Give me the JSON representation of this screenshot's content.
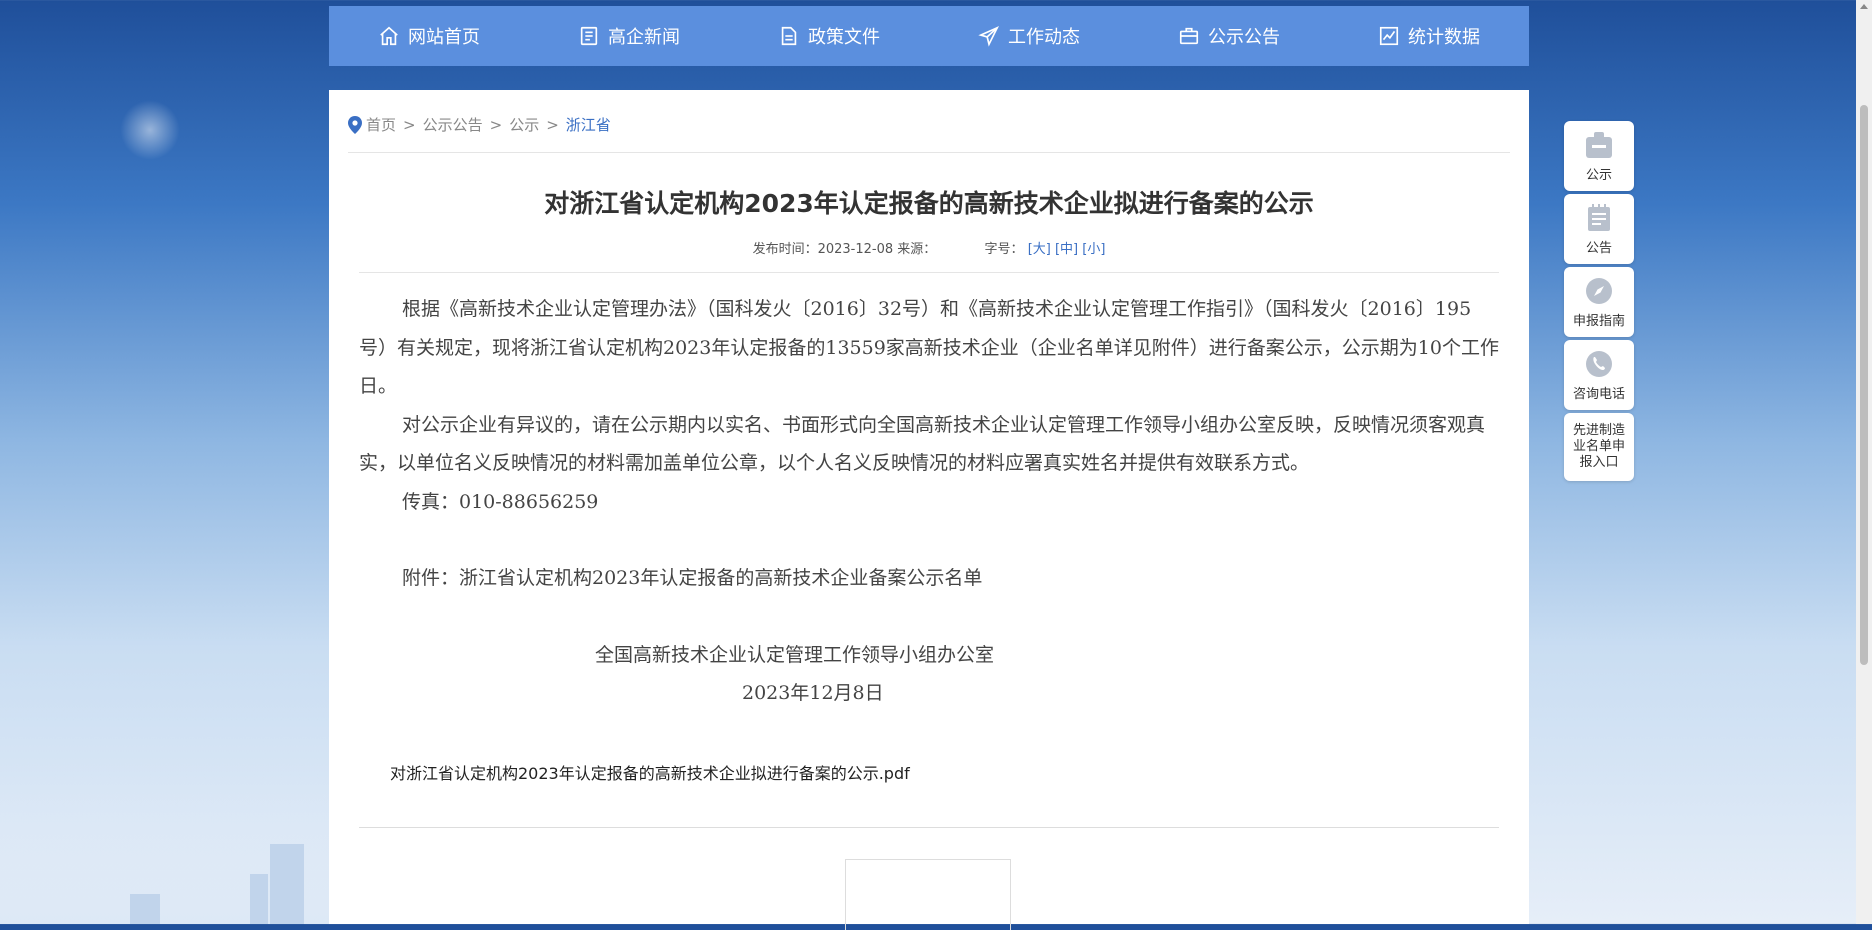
{
  "nav": {
    "items": [
      {
        "label": "网站首页",
        "icon": "home-icon"
      },
      {
        "label": "高企新闻",
        "icon": "news-icon"
      },
      {
        "label": "政策文件",
        "icon": "document-icon"
      },
      {
        "label": "工作动态",
        "icon": "paper-plane-icon"
      },
      {
        "label": "公示公告",
        "icon": "briefcase-icon"
      },
      {
        "label": "统计数据",
        "icon": "chart-icon"
      }
    ]
  },
  "breadcrumb": {
    "items": [
      "首页",
      "公示公告",
      "公示",
      "浙江省"
    ],
    "separator": ">"
  },
  "article": {
    "title": "对浙江省认定机构2023年认定报备的高新技术企业拟进行备案的公示",
    "meta_publish": "发布时间：2023-12-08 来源：",
    "meta_fontsize_label": "字号：",
    "size_large": "[大]",
    "size_medium": "[中]",
    "size_small": "[小]",
    "paragraphs": [
      "根据《高新技术企业认定管理办法》（国科发火〔2016〕32号）和《高新技术企业认定管理工作指引》（国科发火〔2016〕195号）有关规定，现将浙江省认定机构2023年认定报备的13559家高新技术企业（企业名单详见附件）进行备案公示，公示期为10个工作日。",
      "对公示企业有异议的，请在公示期内以实名、书面形式向全国高新技术企业认定管理工作领导小组办公室反映，反映情况须客观真实，以单位名义反映情况的材料需加盖单位公章，以个人名义反映情况的材料应署真实姓名并提供有效联系方式。",
      "传真：010-88656259"
    ],
    "attachment": "附件：浙江省认定机构2023年认定报备的高新技术企业备案公示名单",
    "signature_org": "全国高新技术企业认定管理工作领导小组办公室",
    "signature_date": "2023年12月8日",
    "pdf_link": "对浙江省认定机构2023年认定报备的高新技术企业拟进行备案的公示.pdf"
  },
  "sidebar": {
    "items": [
      {
        "label": "公示",
        "icon": "clipboard-icon"
      },
      {
        "label": "公告",
        "icon": "notepad-icon"
      },
      {
        "label": "申报指南",
        "icon": "compass-icon"
      },
      {
        "label": "咨询电话",
        "icon": "phone-icon"
      },
      {
        "label": "先进制造业名单申报入口"
      }
    ]
  },
  "colors": {
    "nav_bg": "#5b8fde",
    "accent": "#3a6fc4",
    "panel": "#ffffff"
  }
}
